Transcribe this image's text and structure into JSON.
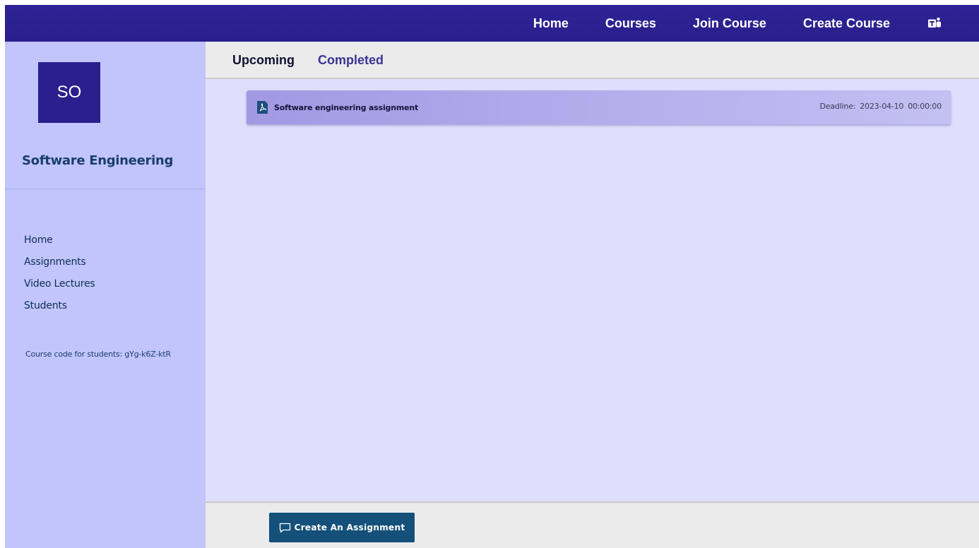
{
  "topnav": {
    "items": [
      {
        "label": "Home"
      },
      {
        "label": "Courses"
      },
      {
        "label": "Join Course"
      },
      {
        "label": "Create Course"
      }
    ],
    "icon": "teams-icon"
  },
  "sidebar": {
    "avatar_text": "SO",
    "course_title": "Software Engineering",
    "items": [
      {
        "label": "Home"
      },
      {
        "label": "Assignments"
      },
      {
        "label": "Video Lectures"
      },
      {
        "label": "Students"
      }
    ],
    "course_code_text": "Course code for students: gYg-k6Z-ktR"
  },
  "tabs": {
    "upcoming": "Upcoming",
    "completed": "Completed"
  },
  "assignments": [
    {
      "icon": "pdf-icon",
      "title": "Software engineering assignment",
      "deadline_label": "Deadline:",
      "deadline_value": "2023-04-10",
      "deadline_time": "00:00:00"
    }
  ],
  "footer": {
    "create_button_label": "Create An Assignment",
    "create_button_icon": "chat-icon"
  },
  "colors": {
    "topbar": "#2a1f8c",
    "sidebar": "#c1c5fc",
    "content": "#dfdffd",
    "button": "#14507a"
  }
}
